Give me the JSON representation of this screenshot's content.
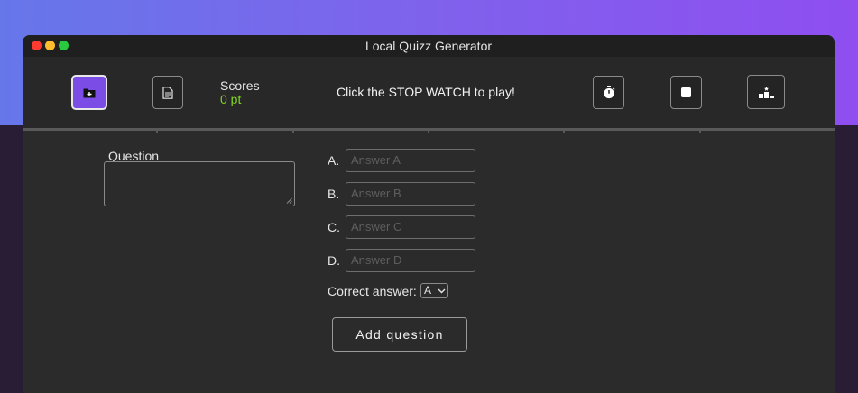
{
  "window": {
    "title": "Local Quizz Generator"
  },
  "toolbar": {
    "new_folder_icon": "folder-plus-icon",
    "document_icon": "document-icon",
    "scores_label": "Scores",
    "scores_value": "0 pt",
    "message": "Click the STOP WATCH to play!",
    "stopwatch_icon": "stopwatch-icon",
    "stop_icon": "stop-icon",
    "leaderboard_icon": "podium-icon"
  },
  "form": {
    "question_label": "Question",
    "answers": [
      {
        "letter": "A.",
        "placeholder": "Answer A"
      },
      {
        "letter": "B.",
        "placeholder": "Answer B"
      },
      {
        "letter": "C.",
        "placeholder": "Answer C"
      },
      {
        "letter": "D.",
        "placeholder": "Answer D"
      }
    ],
    "correct_label": "Correct answer:",
    "correct_value": "A",
    "add_button": "Add question"
  },
  "colors": {
    "accent": "#7b4de6",
    "score": "#7ed321",
    "window_bg": "#2b2b2b"
  }
}
